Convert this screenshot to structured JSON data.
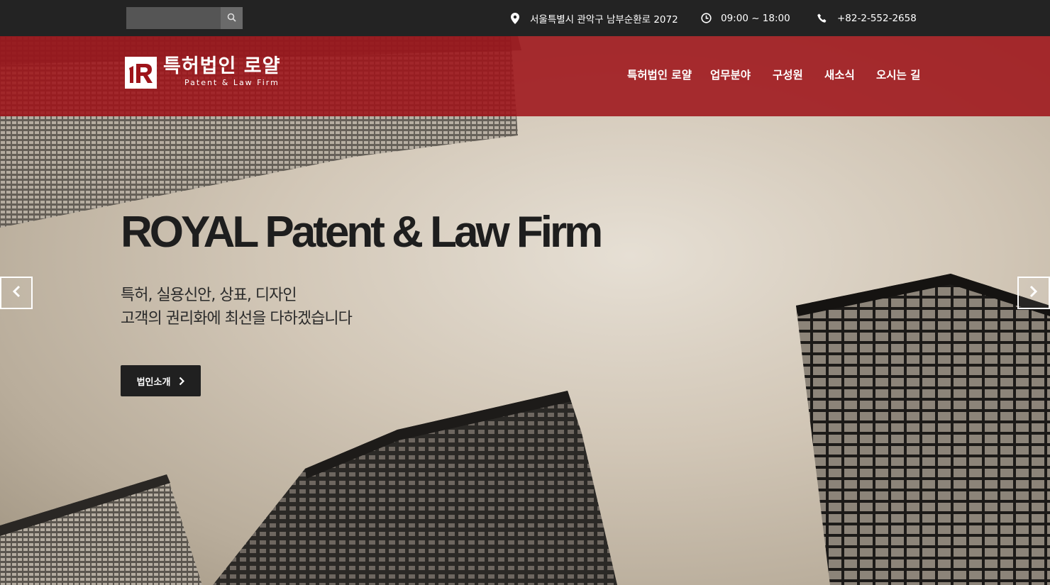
{
  "search": {
    "placeholder": "",
    "button_icon": "search-icon"
  },
  "topbar": {
    "address": "서울특별시 관악구 남부순환로 2072",
    "hours": "09:00 ~ 18:00",
    "phone": "+82-2-552-2658"
  },
  "logo": {
    "name_ko": "특허법인 로얄",
    "name_en": "Patent & Law Firm",
    "mark_letters": "R"
  },
  "nav": {
    "items": [
      {
        "label": "특허법인 로얄"
      },
      {
        "label": "업무분야"
      },
      {
        "label": "구성원"
      },
      {
        "label": "새소식"
      },
      {
        "label": "오시는 길"
      }
    ]
  },
  "hero": {
    "headline": "ROYAL Patent & Law Firm",
    "subline_1": "특허, 실용신안, 상표, 디자인",
    "subline_2": "고객의 권리화에 최선을 다하겠습니다",
    "cta_label": "법인소개"
  },
  "colors": {
    "header_red": "#9e141a",
    "topbar": "#232323",
    "cta": "#202020"
  },
  "icons": {
    "prev": "chevron-left-icon",
    "next": "chevron-right-icon",
    "address": "map-pin-icon",
    "hours": "clock-icon",
    "phone": "phone-icon"
  }
}
